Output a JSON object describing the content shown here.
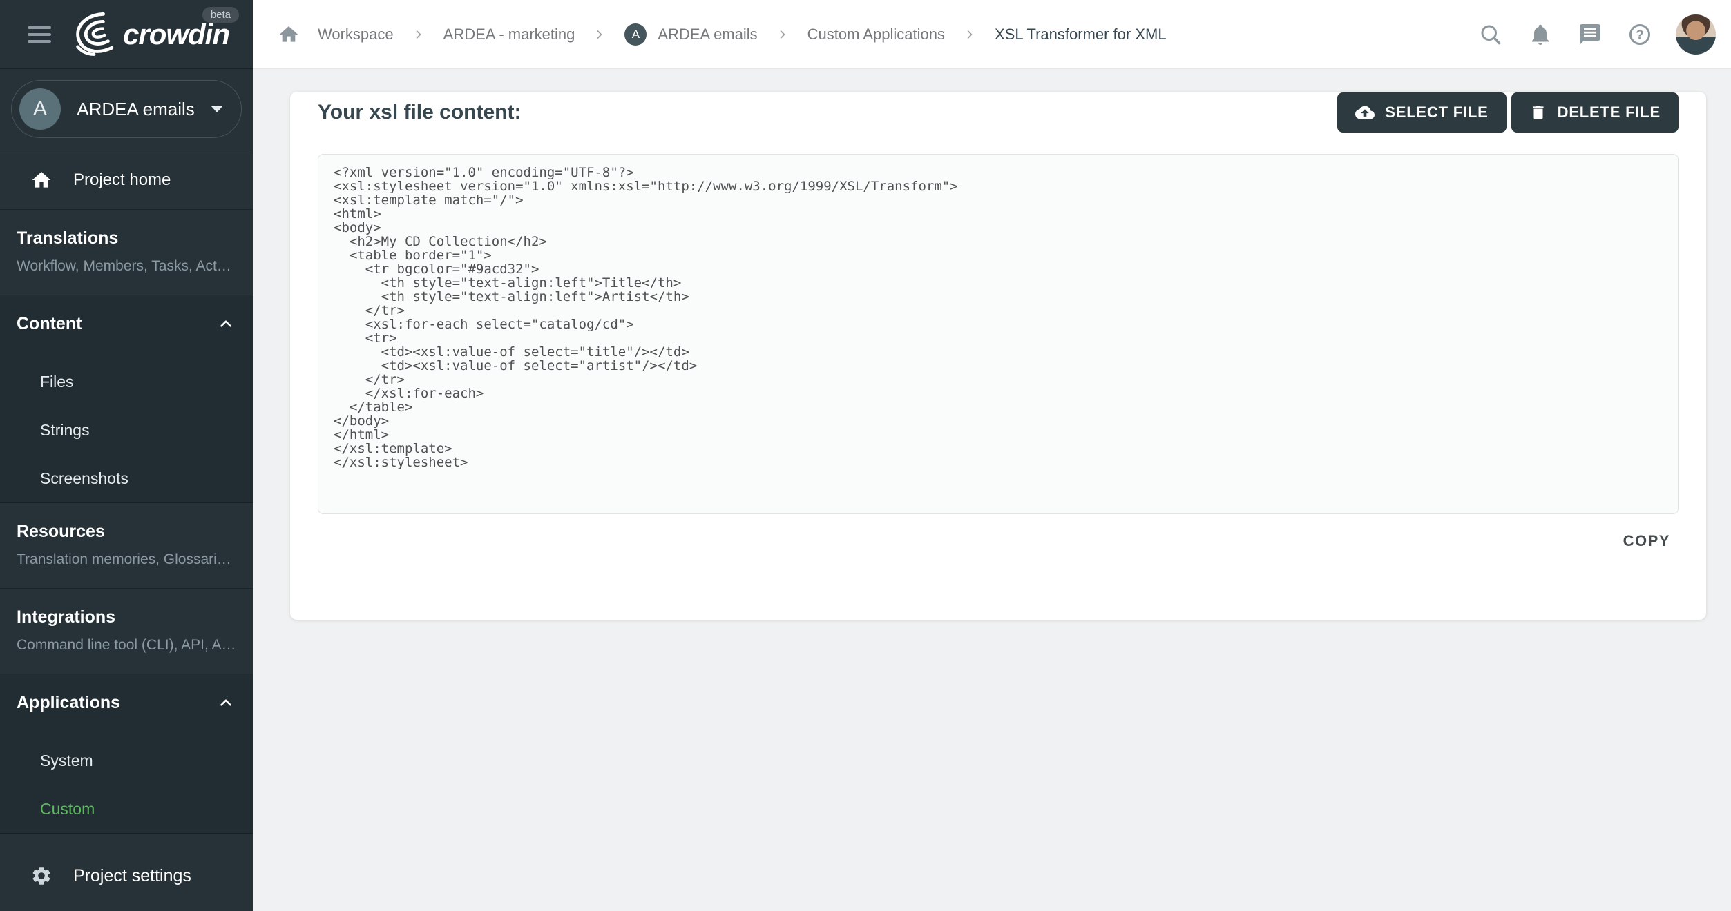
{
  "brand": {
    "logo_text": "crowdin",
    "beta_label": "beta"
  },
  "topbar": {
    "breadcrumb": {
      "items": [
        {
          "label": "Workspace"
        },
        {
          "label": "ARDEA - marketing"
        },
        {
          "label": "ARDEA emails",
          "avatar_letter": "A"
        },
        {
          "label": "Custom Applications"
        },
        {
          "label": "XSL Transformer for XML"
        }
      ]
    },
    "icons": [
      "search-icon",
      "notifications-bell-icon",
      "messages-icon",
      "help-icon",
      "user-avatar"
    ]
  },
  "sidebar": {
    "project_switcher": {
      "avatar_letter": "A",
      "name": "ARDEA emails"
    },
    "project_home_label": "Project home",
    "sections": [
      {
        "title": "Translations",
        "subtitle": "Workflow, Members, Tasks, Act…"
      },
      {
        "title": "Content",
        "expanded": true,
        "items": [
          "Files",
          "Strings",
          "Screenshots"
        ]
      },
      {
        "title": "Resources",
        "subtitle": "Translation memories, Glossari…"
      },
      {
        "title": "Integrations",
        "subtitle": "Command line tool (CLI), API, A…"
      },
      {
        "title": "Applications",
        "expanded": true,
        "items": [
          "System",
          "Custom"
        ],
        "active_item": "Custom"
      }
    ],
    "project_settings_label": "Project settings"
  },
  "main": {
    "heading": "Your xsl file content:",
    "buttons": {
      "select_file": "SELECT FILE",
      "delete_file": "DELETE FILE",
      "copy": "COPY"
    },
    "xsl_code": "<?xml version=\"1.0\" encoding=\"UTF-8\"?>\n<xsl:stylesheet version=\"1.0\" xmlns:xsl=\"http://www.w3.org/1999/XSL/Transform\">\n<xsl:template match=\"/\">\n<html>\n<body>\n  <h2>My CD Collection</h2>\n  <table border=\"1\">\n    <tr bgcolor=\"#9acd32\">\n      <th style=\"text-align:left\">Title</th>\n      <th style=\"text-align:left\">Artist</th>\n    </tr>\n    <xsl:for-each select=\"catalog/cd\">\n    <tr>\n      <td><xsl:value-of select=\"title\"/></td>\n      <td><xsl:value-of select=\"artist\"/></td>\n    </tr>\n    </xsl:for-each>\n  </table>\n</body>\n</html>\n</xsl:template>\n</xsl:stylesheet>"
  },
  "colors": {
    "sidebar_bg": "#263238",
    "sidebar_section_expanded_bg": "#222d33",
    "active_item_green": "#5fb762",
    "button_bg": "#2d3a3f",
    "page_bg": "#f0f1f2",
    "heading_color": "#37474f"
  }
}
